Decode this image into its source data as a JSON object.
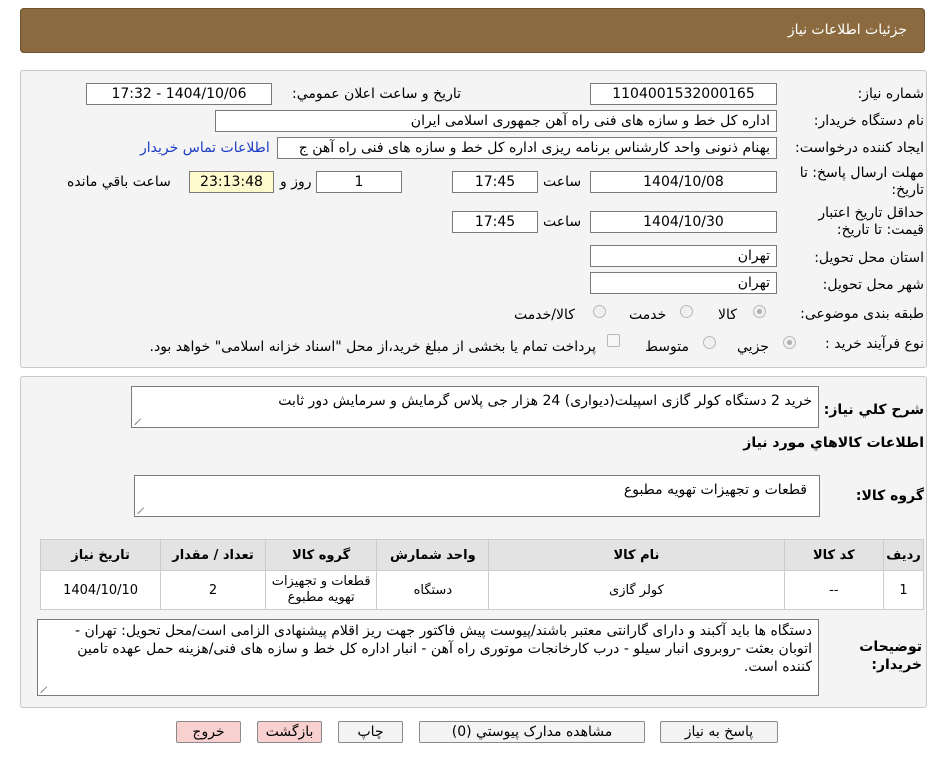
{
  "header": {
    "title": "جزئیات اطلاعات نیاز"
  },
  "form": {
    "need_number_label": "شماره نياز:",
    "need_number": "1104001532000165",
    "announce_label": "تاريخ و ساعت اعلان عمومي:",
    "announce_value": "1404/10/06 - 17:32",
    "buyer_org_label": "نام دستگاه خريدار:",
    "buyer_org": "اداره کل خط و سازه های فنی راه آهن جمهوری اسلامی ایران",
    "requester_label": "ايجاد کننده درخواست:",
    "requester": "بهنام ذنونی واحد کارشناس برنامه ریزی اداره کل خط و سازه های فنی راه آهن ج",
    "contact_link": "اطلاعات تماس خريدار",
    "reply_deadline_label": "مهلت ارسال پاسخ: تا تاريخ:",
    "reply_date": "1404/10/08",
    "time_label": "ساعت",
    "reply_time": "17:45",
    "days": "1",
    "days_label": "روز و",
    "remaining_time": "23:13:48",
    "remaining_label": "ساعت باقي مانده",
    "validity_label": "حداقل تاريخ اعتبار قيمت: تا تاريخ:",
    "validity_date": "1404/10/30",
    "validity_time": "17:45",
    "province_label": "استان محل تحويل:",
    "province": "تهران",
    "city_label": "شهر محل تحويل:",
    "city": "تهران",
    "category_label": "طبقه بندی موضوعی:",
    "category_options": [
      "کالا",
      "خدمت",
      "کالا/خدمت"
    ],
    "process_label": "نوع فرآيند خريد :",
    "process_options": [
      "جزيي",
      "متوسط"
    ],
    "payment_note": "پرداخت تمام يا بخشی از مبلغ خريد،از محل \"اسناد خزانه اسلامی\" خواهد بود."
  },
  "description": {
    "label": "شرح کلي نياز:",
    "text": "خرید 2 دستگاه کولر گازی اسپیلت(دیواری) 24 هزار جی پلاس گرمایش و سرمایش دور ثابت"
  },
  "goods_info": {
    "title": "اطلاعات کالاهاي مورد نياز",
    "group_label": "گروه کالا:",
    "group_value": "قطعات و تجهیزات تهویه مطبوع"
  },
  "items_table": {
    "headers": [
      "رديف",
      "کد کالا",
      "نام کالا",
      "واحد شمارش",
      "گروه کالا",
      "تعداد / مقدار",
      "تاريخ نياز"
    ],
    "rows": [
      [
        "1",
        "--",
        "کولر گازی",
        "دستگاه",
        "قطعات و تجهیزات تهویه مطبوع",
        "2",
        "1404/10/10"
      ]
    ]
  },
  "buyer_notes": {
    "label": "توضيحات خريدار:",
    "text": "دستگاه ها باید آکبند و دارای گارانتی معتبر باشند/پیوست پیش فاکتور جهت ریز اقلام پیشنهادی الزامی است/محل تحویل: تهران - اتوبان بعثت -روبروی انبار سیلو - درب کارخانجات موتوری راه آهن - انبار اداره کل خط و سازه های فنی/هزینه حمل عهده تامین کننده است."
  },
  "buttons": {
    "reply": "پاسخ به نياز",
    "attachments": "مشاهده مدارک پيوستي (0)",
    "print": "چاپ",
    "back": "بازگشت",
    "exit": "خروج"
  },
  "colors": {
    "header_bg": "#8a6a3e",
    "link": "#1a3cc8",
    "highlight": "#fffacd"
  }
}
